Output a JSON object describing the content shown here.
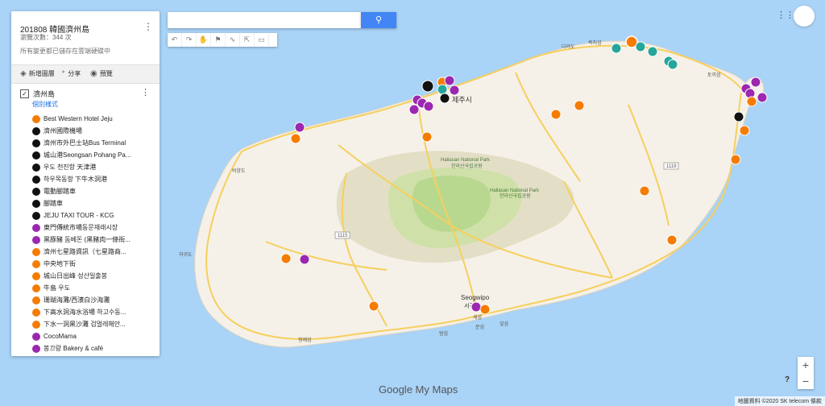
{
  "map": {
    "title": "201808 韓國濟州島",
    "views": "瀏覽次數：344 次",
    "saved": "所有變更都已儲存在雲端硬碟中",
    "toolbar": {
      "add_layer": "新增圖層",
      "share": "分享",
      "preview": "預覽"
    },
    "layer": {
      "name": "濟州島",
      "style_link": "個別樣式",
      "items": [
        {
          "label": "Best Western Hotel Jeju",
          "color": "#f57c00",
          "icon": "home-icon"
        },
        {
          "label": "濟州國際機場",
          "color": "#111111",
          "icon": "plane-icon"
        },
        {
          "label": "濟州市外巴士站Bus Terminal",
          "color": "#111111",
          "icon": "bus-icon"
        },
        {
          "label": "城山港Seongsan Pohang Pa...",
          "color": "#111111",
          "icon": "ferry-icon"
        },
        {
          "label": "우도 천진항 天津港",
          "color": "#111111",
          "icon": "ferry-icon"
        },
        {
          "label": "하우목동항 下牛木洞港",
          "color": "#111111",
          "icon": "ferry-icon"
        },
        {
          "label": "電動腳踏車",
          "color": "#111111",
          "icon": "bike-icon"
        },
        {
          "label": "腳踏車",
          "color": "#111111",
          "icon": "bike-icon"
        },
        {
          "label": "JEJU TAXI TOUR - KCG",
          "color": "#111111",
          "icon": "taxi-icon"
        },
        {
          "label": "東門傳統市場동문재래시장",
          "color": "#9c27b0",
          "icon": "restaurant-icon"
        },
        {
          "label": "黑豚豬 돔베돈 (黑豬肉一條街...",
          "color": "#9c27b0",
          "icon": "restaurant-icon"
        },
        {
          "label": "濟州七星路資訊（七星路商...",
          "color": "#f57c00",
          "icon": "camera-icon"
        },
        {
          "label": "中央地下街",
          "color": "#f57c00",
          "icon": "camera-icon"
        },
        {
          "label": "城山日出峰 성산일출봉",
          "color": "#f57c00",
          "icon": "camera-icon"
        },
        {
          "label": "牛島 우도",
          "color": "#f57c00",
          "icon": "camera-icon"
        },
        {
          "label": "珊瑚海灘/西濱白沙海灘",
          "color": "#f57c00",
          "icon": "camera-icon"
        },
        {
          "label": "下高水洞海水浴場 하고수동...",
          "color": "#f57c00",
          "icon": "camera-icon"
        },
        {
          "label": "下水一洞黑沙灘 검멀레해안...",
          "color": "#f57c00",
          "icon": "camera-icon"
        },
        {
          "label": "CocoMama",
          "color": "#9c27b0",
          "icon": "restaurant-icon"
        },
        {
          "label": "봉끄랑 Bakery & café",
          "color": "#9c27b0",
          "icon": "restaurant-icon"
        }
      ]
    }
  },
  "labels": {
    "national_park": "Hallasan National Park",
    "national_park_kr": "한라산국립공원",
    "seogwipo": "Seogwipo",
    "seogwipo_kr": "서귀포",
    "jeju_city": "제주시",
    "road_1115": "1115",
    "road_1119": "1119",
    "place_1": "비양도",
    "place_2": "자귀도",
    "place_3": "형제섬",
    "place_4": "범섬",
    "place_5": "문섬",
    "place_6": "섶섬",
    "place_7": "세섬",
    "place_8": "토끼섬",
    "place_9": "다려도",
    "place_10": "목지섬"
  },
  "footer": {
    "logo_google": "Google",
    "logo_mymaps": "My Maps",
    "attribution": "地圖資料 ©2020 SK telecom",
    "terms": "條款",
    "help": "?"
  }
}
